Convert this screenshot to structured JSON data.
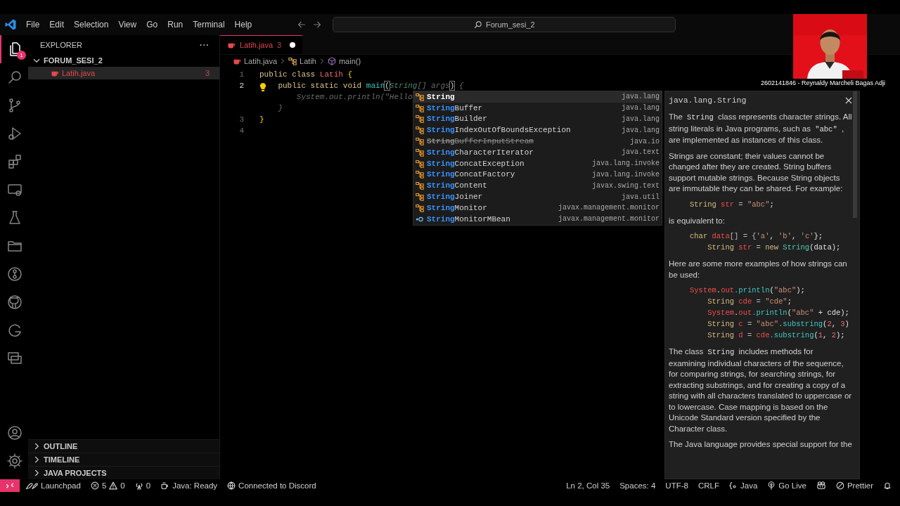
{
  "menu": [
    "File",
    "Edit",
    "Selection",
    "View",
    "Go",
    "Run",
    "Terminal",
    "Help"
  ],
  "command_center": "Forum_sesi_2",
  "activity_bar": [
    {
      "selected": true,
      "badge": "1"
    },
    {
      "selected": false
    },
    {
      "selected": false
    },
    {
      "selected": false
    },
    {
      "selected": false
    },
    {
      "selected": false
    },
    {
      "selected": false
    },
    {
      "selected": false
    },
    {
      "selected": false
    },
    {
      "selected": false
    },
    {
      "selected": false
    },
    {
      "selected": false
    }
  ],
  "sidebar": {
    "title": "EXPLORER",
    "more": "···",
    "folder": {
      "name": "FORUM_SESI_2",
      "expanded": true,
      "files": [
        {
          "name": "Latih.java",
          "problems": "3",
          "selected": true
        }
      ]
    },
    "sections": [
      {
        "name": "OUTLINE",
        "expanded": false
      },
      {
        "name": "TIMELINE",
        "expanded": false
      },
      {
        "name": "JAVA PROJECTS",
        "expanded": false
      }
    ]
  },
  "tabs": [
    {
      "label": "Latih.java",
      "problems": "3",
      "modified": true,
      "selected": true
    }
  ],
  "breadcrumbs": [
    {
      "text": "Latih.java",
      "kind": "file"
    },
    {
      "text": "Latih",
      "kind": "class"
    },
    {
      "text": "main()",
      "kind": "method"
    }
  ],
  "code": [
    {
      "number": "1",
      "current": false,
      "tokens": [
        {
          "text": "public class ",
          "kind": "keyword"
        },
        {
          "text": "Latih",
          "kind": "class"
        },
        {
          "text": " {",
          "kind": "brace"
        }
      ]
    },
    {
      "number": "2",
      "current": true,
      "tokens": [
        {
          "text": "    public static void ",
          "kind": "keyword"
        },
        {
          "text": "main",
          "kind": "function"
        },
        {
          "text": "(",
          "kind": "bracket"
        },
        {
          "text": "String",
          "kind": "ghost-type"
        },
        {
          "text": "[] args",
          "kind": "ghost"
        },
        {
          "text": ")",
          "kind": "bracket"
        },
        {
          "text": " {",
          "kind": "ghost"
        }
      ]
    },
    {
      "tokens": [
        {
          "text": "        System.out.println(\"Hello",
          "kind": "ghost"
        }
      ]
    },
    {
      "tokens": [
        {
          "text": "    }",
          "kind": "ghost"
        }
      ]
    },
    {
      "number": "3",
      "current": false,
      "tokens": [
        {
          "text": "}",
          "kind": "brace"
        }
      ]
    },
    {
      "number": "4",
      "current": false
    }
  ],
  "suggestions": [
    {
      "match": "String",
      "detail": "java.lang",
      "kind": "class",
      "deprecated": false,
      "selected": true
    },
    {
      "match": "String",
      "rest": "Buffer",
      "detail": "java.lang",
      "kind": "class",
      "deprecated": false,
      "selected": false
    },
    {
      "match": "String",
      "rest": "Builder",
      "detail": "java.lang",
      "kind": "class",
      "deprecated": false,
      "selected": false
    },
    {
      "match": "String",
      "rest": "IndexOutOfBoundsException",
      "detail": "java.lang",
      "kind": "class",
      "deprecated": false,
      "selected": false
    },
    {
      "match": "String",
      "rest": "BufferInputStream",
      "detail": "java.io",
      "kind": "class",
      "deprecated": true,
      "selected": false
    },
    {
      "match": "String",
      "rest": "CharacterIterator",
      "detail": "java.text",
      "kind": "class",
      "deprecated": false,
      "selected": false
    },
    {
      "match": "String",
      "rest": "ConcatException",
      "detail": "java.lang.invoke",
      "kind": "class",
      "deprecated": false,
      "selected": false
    },
    {
      "match": "String",
      "rest": "ConcatFactory",
      "detail": "java.lang.invoke",
      "kind": "class",
      "deprecated": false,
      "selected": false
    },
    {
      "match": "String",
      "rest": "Content",
      "detail": "javax.swing.text",
      "kind": "class",
      "deprecated": false,
      "selected": false
    },
    {
      "match": "String",
      "rest": "Joiner",
      "detail": "java.util",
      "kind": "class",
      "deprecated": false,
      "selected": false
    },
    {
      "match": "String",
      "rest": "Monitor",
      "detail": "javax.management.monitor",
      "kind": "class",
      "deprecated": false,
      "selected": false
    },
    {
      "match": "String",
      "rest": "MonitorMBean",
      "detail": "javax.management.monitor",
      "kind": "interface",
      "deprecated": false,
      "selected": false
    }
  ],
  "docs": {
    "title": "java.lang.String",
    "blocks": [
      {
        "kind": "text",
        "parts": [
          {
            "text": "The "
          },
          {
            "text": "String",
            "code": true
          },
          {
            "text": " class represents character strings. All string literals in Java programs, such as "
          },
          {
            "text": "\"abc\"",
            "code": true
          },
          {
            "text": " , are implemented as instances of this class."
          }
        ]
      },
      {
        "kind": "text",
        "parts": [
          {
            "text": "Strings are constant; their values cannot be changed after they are created. String buffers support mutable strings. Because String objects are immutable they can be shared. For example:"
          }
        ]
      },
      {
        "kind": "code",
        "lines": [
          {
            "tokens": [
              {
                "text": "String",
                "kind": "type"
              },
              {
                "text": " str",
                "kind": "var"
              },
              {
                "text": " = ",
                "kind": "op"
              },
              {
                "text": "\"abc\"",
                "kind": "string"
              },
              {
                "text": ";",
                "kind": "plain"
              }
            ]
          }
        ]
      },
      {
        "kind": "text",
        "parts": [
          {
            "text": "is equivalent to:"
          }
        ]
      },
      {
        "kind": "code",
        "lines": [
          {
            "tokens": [
              {
                "text": "char",
                "kind": "type"
              },
              {
                "text": " data",
                "kind": "var"
              },
              {
                "text": "[] = {",
                "kind": "op"
              },
              {
                "text": "'a'",
                "kind": "string"
              },
              {
                "text": ", ",
                "kind": "plain"
              },
              {
                "text": "'b'",
                "kind": "string"
              },
              {
                "text": ", ",
                "kind": "plain"
              },
              {
                "text": "'c'",
                "kind": "string"
              },
              {
                "text": "};",
                "kind": "plain"
              }
            ]
          },
          {
            "tokens": [
              {
                "text": "    String",
                "kind": "type"
              },
              {
                "text": " str",
                "kind": "var"
              },
              {
                "text": " = ",
                "kind": "op"
              },
              {
                "text": "new ",
                "kind": "type"
              },
              {
                "text": "String",
                "kind": "class"
              },
              {
                "text": "(data);",
                "kind": "plain"
              }
            ]
          }
        ]
      },
      {
        "kind": "text",
        "parts": [
          {
            "text": "Here are some more examples of how strings can be used:"
          }
        ]
      },
      {
        "kind": "code",
        "lines": [
          {
            "tokens": [
              {
                "text": "System",
                "kind": "var"
              },
              {
                "text": ".",
                "kind": "plain"
              },
              {
                "text": "out",
                "kind": "var"
              },
              {
                "text": ".println",
                "kind": "method"
              },
              {
                "text": "(",
                "kind": "plain"
              },
              {
                "text": "\"abc\"",
                "kind": "string"
              },
              {
                "text": ");",
                "kind": "plain"
              }
            ]
          },
          {
            "tokens": [
              {
                "text": "    String",
                "kind": "type"
              },
              {
                "text": " cde",
                "kind": "var"
              },
              {
                "text": " = ",
                "kind": "op"
              },
              {
                "text": "\"cde\"",
                "kind": "string"
              },
              {
                "text": ";",
                "kind": "plain"
              }
            ]
          },
          {
            "tokens": [
              {
                "text": "    System",
                "kind": "var"
              },
              {
                "text": ".",
                "kind": "plain"
              },
              {
                "text": "out",
                "kind": "var"
              },
              {
                "text": ".println",
                "kind": "method"
              },
              {
                "text": "(",
                "kind": "plain"
              },
              {
                "text": "\"abc\"",
                "kind": "string"
              },
              {
                "text": " + cde);",
                "kind": "plain"
              }
            ]
          },
          {
            "tokens": [
              {
                "text": "    String",
                "kind": "type"
              },
              {
                "text": " c",
                "kind": "var"
              },
              {
                "text": " = ",
                "kind": "op"
              },
              {
                "text": "\"abc\"",
                "kind": "string"
              },
              {
                "text": ".substring",
                "kind": "method"
              },
              {
                "text": "(",
                "kind": "plain"
              },
              {
                "text": "2",
                "kind": "number"
              },
              {
                "text": ", ",
                "kind": "plain"
              },
              {
                "text": "3",
                "kind": "number"
              },
              {
                "text": ")",
                "kind": "plain"
              }
            ]
          },
          {
            "tokens": [
              {
                "text": "    String",
                "kind": "type"
              },
              {
                "text": " d",
                "kind": "var"
              },
              {
                "text": " = ",
                "kind": "op"
              },
              {
                "text": "cde",
                "kind": "var"
              },
              {
                "text": ".substring",
                "kind": "method"
              },
              {
                "text": "(",
                "kind": "plain"
              },
              {
                "text": "1",
                "kind": "number"
              },
              {
                "text": ", ",
                "kind": "plain"
              },
              {
                "text": "2",
                "kind": "number"
              },
              {
                "text": ");",
                "kind": "plain"
              }
            ]
          }
        ]
      },
      {
        "kind": "text",
        "parts": [
          {
            "text": "The class "
          },
          {
            "text": "String",
            "code": true
          },
          {
            "text": " includes methods for examining individual characters of the sequence, for comparing strings, for searching strings, for extracting substrings, and for creating a copy of a string with all characters translated to uppercase or to lowercase. Case mapping is based on the Unicode Standard version specified by the Character class."
          }
        ]
      },
      {
        "kind": "text",
        "parts": [
          {
            "text": "The Java language provides special support for the"
          }
        ]
      }
    ]
  },
  "webcam": {
    "caption": "2602141846 - Reynaldy Marcheli Bagas Adji"
  },
  "status_left": [
    {
      "kind": "launchpad",
      "text": "Launchpad"
    },
    {
      "kind": "problems",
      "errors": "5",
      "warnings": "0"
    },
    {
      "kind": "ports",
      "text": "0"
    },
    {
      "kind": "java",
      "text": "Java: Ready"
    },
    {
      "kind": "discord",
      "text": "Connected to Discord"
    }
  ],
  "status_right": [
    {
      "kind": "plain",
      "text": "Ln 2, Col 35"
    },
    {
      "kind": "plain",
      "text": "Spaces: 4"
    },
    {
      "kind": "plain",
      "text": "UTF-8"
    },
    {
      "kind": "plain",
      "text": "CRLF"
    },
    {
      "kind": "language",
      "text": "Java"
    },
    {
      "kind": "live",
      "text": "Go Live"
    },
    {
      "kind": "copilot"
    },
    {
      "kind": "prettier",
      "text": "Prettier"
    },
    {
      "kind": "bell"
    }
  ]
}
